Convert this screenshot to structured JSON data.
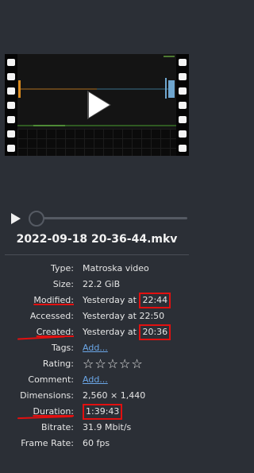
{
  "file": {
    "name": "2022-09-18 20-36-44.mkv"
  },
  "properties": [
    {
      "label": "Type:",
      "value": "Matroska video"
    },
    {
      "label": "Size:",
      "value": "22.2 GiB"
    },
    {
      "label": "Modified:",
      "value_prefix": "Yesterday at ",
      "value_highlight": "22:44"
    },
    {
      "label": "Accessed:",
      "value": "Yesterday at 22:50"
    },
    {
      "label": "Created:",
      "value_prefix": "Yesterday at ",
      "value_highlight": "20:36"
    },
    {
      "label": "Tags:",
      "link": "Add..."
    },
    {
      "label": "Rating:",
      "stars": "☆☆☆☆☆"
    },
    {
      "label": "Comment:",
      "link": "Add..."
    },
    {
      "label": "Dimensions:",
      "value": "2,560 × 1,440"
    },
    {
      "label": "Duration:",
      "value_highlight": "1:39:43"
    },
    {
      "label": "Bitrate:",
      "value": "31.9 Mbit/s"
    },
    {
      "label": "Frame Rate:",
      "value": "60 fps"
    }
  ],
  "colors": {
    "background": "#2b2f36",
    "link": "#6ba7e8",
    "annotation": "#e11010"
  }
}
